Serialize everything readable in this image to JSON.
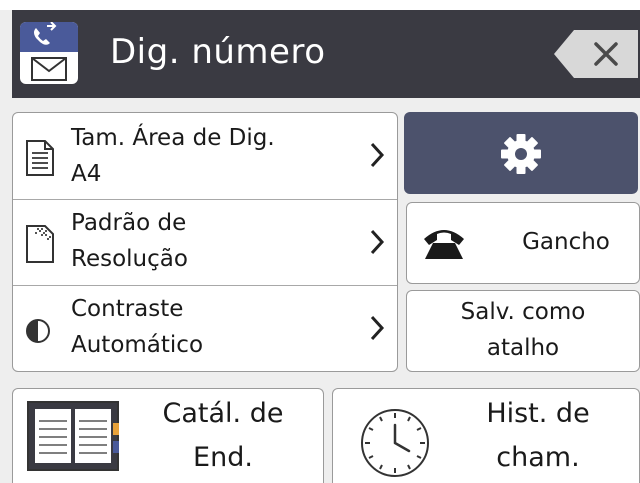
{
  "header": {
    "title": "Dig. número",
    "icon": "fax-icon",
    "clear_icon": "backspace-icon"
  },
  "settings": [
    {
      "icon": "document-size-icon",
      "line1": "Tam. Área de Dig.",
      "line2": "A4"
    },
    {
      "icon": "resolution-icon",
      "line1": "Padrão de",
      "line2": "Resolução"
    },
    {
      "icon": "contrast-icon",
      "line1": "Contraste",
      "line2": "Automático"
    }
  ],
  "buttons": {
    "settings_icon": "gear-icon",
    "hook_icon": "phone-handset-icon",
    "hook_label": "Gancho",
    "shortcut_line1": "Salv. como",
    "shortcut_line2": "atalho",
    "address_book_icon": "address-book-icon",
    "address_book_line1": "Catál. de",
    "address_book_line2": "End.",
    "call_history_icon": "clock-icon",
    "call_history_line1": "Hist. de",
    "call_history_line2": "cham."
  },
  "colors": {
    "header_bg": "#3a3a42",
    "settings_button_bg": "#4c526c",
    "fax_icon_accent": "#4a5a9a"
  }
}
